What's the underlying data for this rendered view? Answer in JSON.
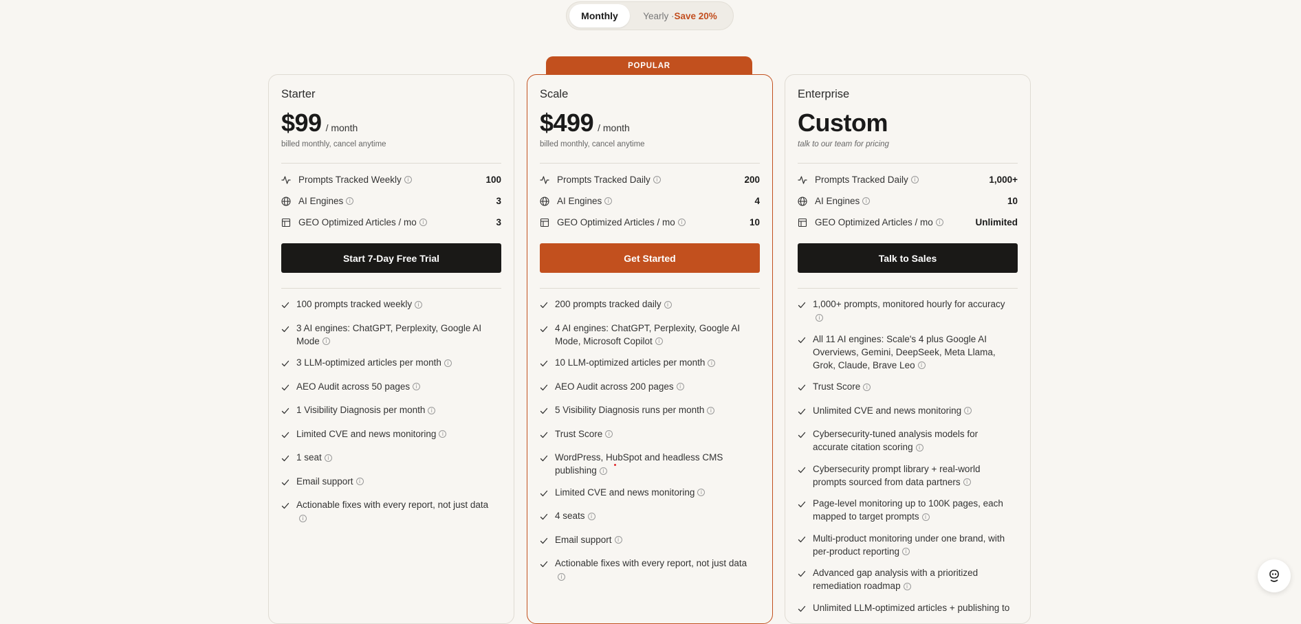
{
  "billing_toggle": {
    "monthly_label": "Monthly",
    "yearly_label": "Yearly · ",
    "yearly_save": "Save 20%",
    "selected": "Monthly"
  },
  "popular_label": "POPULAR",
  "colors": {
    "accent": "#c2501e",
    "dark": "#1a1917",
    "background": "#f8f6f2"
  },
  "plans": [
    {
      "name": "Starter",
      "price": "$99",
      "period": "/ month",
      "billed": "billed monthly, cancel anytime",
      "stats": [
        {
          "icon": "activity-icon",
          "label": "Prompts Tracked Weekly",
          "value": "100"
        },
        {
          "icon": "globe-icon",
          "label": "AI Engines",
          "value": "3"
        },
        {
          "icon": "document-icon",
          "label": "GEO Optimized Articles / mo",
          "value": "3"
        }
      ],
      "cta": "Start 7-Day Free Trial",
      "features": [
        "100 prompts tracked weekly",
        "3 AI engines: ChatGPT, Perplexity, Google AI Mode",
        "3 LLM-optimized articles per month",
        "AEO Audit across 50 pages",
        "1 Visibility Diagnosis per month",
        "Limited CVE and news monitoring",
        "1 seat",
        "Email support",
        "Actionable fixes with every report, not just data"
      ]
    },
    {
      "name": "Scale",
      "price": "$499",
      "period": "/ month",
      "billed": "billed monthly, cancel anytime",
      "stats": [
        {
          "icon": "activity-icon",
          "label": "Prompts Tracked Daily",
          "value": "200"
        },
        {
          "icon": "globe-icon",
          "label": "AI Engines",
          "value": "4"
        },
        {
          "icon": "document-icon",
          "label": "GEO Optimized Articles / mo",
          "value": "10"
        }
      ],
      "cta": "Get Started",
      "features": [
        "200 prompts tracked daily",
        "4 AI engines: ChatGPT, Perplexity, Google AI Mode, Microsoft Copilot",
        "10 LLM-optimized articles per month",
        "AEO Audit across 200 pages",
        "5 Visibility Diagnosis runs per month",
        "Trust Score",
        "WordPress, HubSpot and headless CMS publishing",
        "Limited CVE and news monitoring",
        "4 seats",
        "Email support",
        "Actionable fixes with every report, not just data"
      ]
    },
    {
      "name": "Enterprise",
      "price": "Custom",
      "period": "",
      "billed": "talk to our team for pricing",
      "stats": [
        {
          "icon": "activity-icon",
          "label": "Prompts Tracked Daily",
          "value": "1,000+"
        },
        {
          "icon": "globe-icon",
          "label": "AI Engines",
          "value": "10"
        },
        {
          "icon": "document-icon",
          "label": "GEO Optimized Articles / mo",
          "value": "Unlimited"
        }
      ],
      "cta": "Talk to Sales",
      "features": [
        "1,000+ prompts, monitored hourly for accuracy",
        "All 11 AI engines: Scale's 4 plus Google AI Overviews, Gemini, DeepSeek, Meta Llama, Grok, Claude, Brave Leo",
        "Trust Score",
        "Unlimited CVE and news monitoring",
        "Cybersecurity-tuned analysis models for accurate citation scoring",
        "Cybersecurity prompt library + real-world prompts sourced from data partners",
        "Page-level monitoring up to 100K pages, each mapped to target prompts",
        "Multi-product monitoring under one brand, with per-product reporting",
        "Advanced gap analysis with a prioritized remediation roadmap",
        "Unlimited LLM-optimized articles + publishing to"
      ]
    }
  ]
}
